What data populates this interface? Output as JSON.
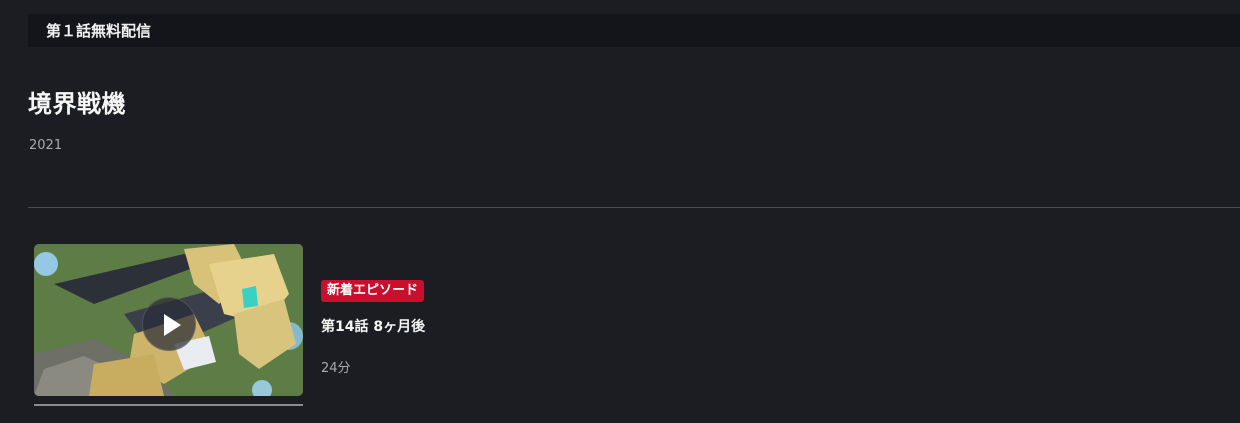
{
  "banner": {
    "label": "第１話無料配信"
  },
  "series": {
    "title": "境界戦機",
    "year": "2021"
  },
  "episode": {
    "badge": "新着エピソード",
    "title": "第14話 8ヶ月後",
    "duration": "24分",
    "progress": 0,
    "thumbnail_icon": "play-icon"
  },
  "colors": {
    "background": "#1c1d22",
    "banner_bg": "#14151b",
    "badge": "#c8102e",
    "muted_text": "#a9a9ad"
  }
}
